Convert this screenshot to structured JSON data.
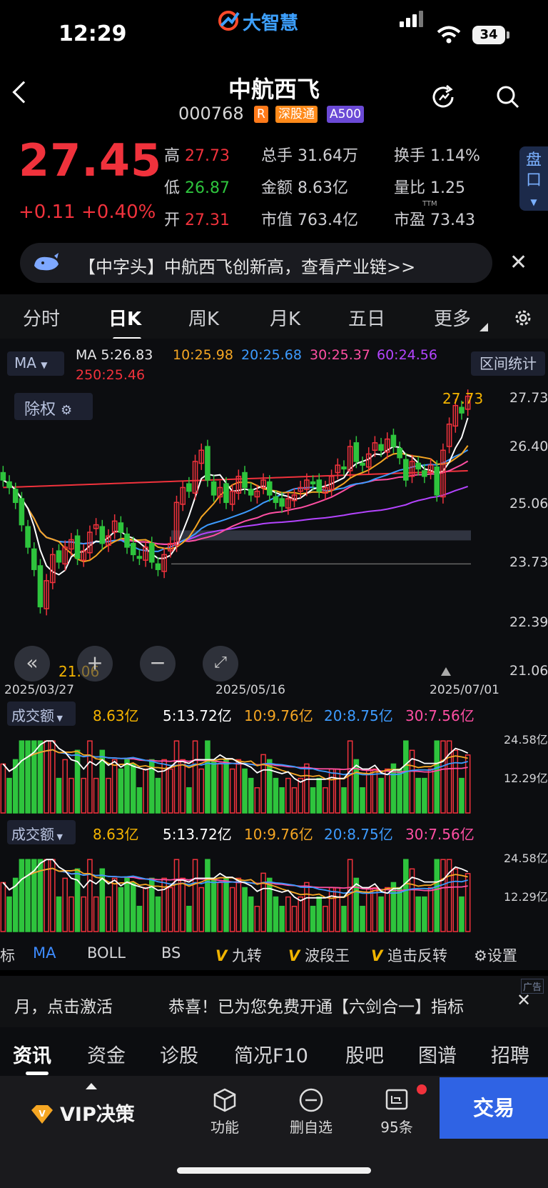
{
  "status_bar": {
    "time": "12:29",
    "brand": "大智慧",
    "battery": "34"
  },
  "header": {
    "title": "中航西飞",
    "code": "000768",
    "badges": [
      "R",
      "深股通",
      "A500"
    ]
  },
  "quote": {
    "price": "27.45",
    "change": "+0.11",
    "change_pct": "+0.40%",
    "stats": [
      {
        "label": "高",
        "value": "27.73"
      },
      {
        "label": "低",
        "value": "26.87"
      },
      {
        "label": "开",
        "value": "27.31"
      },
      {
        "label": "总手",
        "value": "31.64万"
      },
      {
        "label": "金额",
        "value": "8.63亿"
      },
      {
        "label": "市值",
        "value": "763.4亿"
      },
      {
        "label": "换手",
        "value": "1.14%"
      },
      {
        "label": "量比",
        "value": "1.25"
      },
      {
        "label": "市盈",
        "value": "73.43",
        "sup": "TTM"
      }
    ],
    "pankou": "盘口"
  },
  "banner": {
    "text": "【中字头】中航西飞创新高，查看产业链>>"
  },
  "chart_tabs": [
    "分时",
    "日K",
    "周K",
    "月K",
    "五日",
    "更多"
  ],
  "kline": {
    "indicator": "MA",
    "legend": [
      {
        "label": "MA 5:26.83",
        "color": "#ffffff"
      },
      {
        "label": "10:25.98",
        "color": "#f5a623"
      },
      {
        "label": "20:25.68",
        "color": "#3d9bff"
      },
      {
        "label": "30:25.37",
        "color": "#ff4fa3"
      },
      {
        "label": "60:24.56",
        "color": "#b444ff"
      },
      {
        "label": "250:25.46",
        "color": "#f0323c"
      }
    ],
    "range_stats": "区间统计",
    "chuquan": "除权",
    "y_labels": [
      "27.73",
      "26.40",
      "25.06",
      "23.73",
      "22.39",
      "21.06"
    ],
    "high_label": "27.73",
    "low_label": "21.06",
    "dates": [
      "2025/03/27",
      "2025/05/16",
      "2025/07/01"
    ]
  },
  "volume_panels": [
    {
      "selector": "成交额",
      "today": "8.63亿",
      "ma5": "5:13.72亿",
      "ma10": "10:9.76亿",
      "ma20": "20:8.75亿",
      "ma30": "30:7.56亿",
      "y_top": "24.58亿",
      "y_mid": "12.29亿"
    },
    {
      "selector": "成交额",
      "today": "8.63亿",
      "ma5": "5:13.72亿",
      "ma10": "10:9.76亿",
      "ma20": "20:8.75亿",
      "ma30": "30:7.56亿",
      "y_top": "24.58亿",
      "y_mid": "12.29亿"
    }
  ],
  "indicator_bar": {
    "items": [
      "标",
      "MA",
      "BOLL",
      "BS"
    ],
    "v_items": [
      "九转",
      "波段王",
      "追击反转"
    ],
    "settings": "设置"
  },
  "ad": {
    "text_left": "月，点击激活",
    "text_right": "恭喜！已为您免费开通【六剑合一】指标",
    "tag": "广告"
  },
  "section_tabs": [
    "资讯",
    "资金",
    "诊股",
    "简况F10",
    "股吧",
    "图谱",
    "招聘"
  ],
  "bottom_nav": {
    "vip": "VIP决策",
    "items": [
      "功能",
      "删自选",
      "95条"
    ],
    "trade": "交易"
  },
  "chart_data": {
    "type": "candlestick",
    "x_start": "2025/03/27",
    "x_end": "2025/07/01",
    "ylim": [
      21.06,
      27.73
    ],
    "close": [
      25.2,
      25.0,
      24.6,
      24.0,
      23.4,
      22.8,
      21.8,
      22.5,
      23.2,
      23.0,
      23.4,
      23.6,
      23.1,
      23.3,
      23.8,
      24.0,
      23.5,
      23.7,
      24.1,
      23.8,
      23.4,
      23.2,
      23.1,
      23.4,
      23.0,
      22.8,
      23.2,
      23.5,
      24.6,
      25.0,
      24.9,
      25.7,
      26.0,
      25.2,
      24.8,
      25.0,
      24.6,
      24.9,
      25.3,
      25.0,
      24.8,
      24.9,
      25.2,
      24.8,
      24.6,
      24.5,
      24.7,
      24.8,
      25.0,
      25.2,
      25.1,
      24.9,
      25.0,
      25.3,
      25.6,
      25.5,
      26.1,
      25.7,
      25.6,
      25.9,
      26.2,
      26.0,
      26.3,
      26.1,
      25.8,
      25.2,
      25.7,
      25.5,
      25.3,
      25.6,
      24.8,
      26.0,
      26.7,
      27.2,
      27.0,
      27.45
    ]
  }
}
